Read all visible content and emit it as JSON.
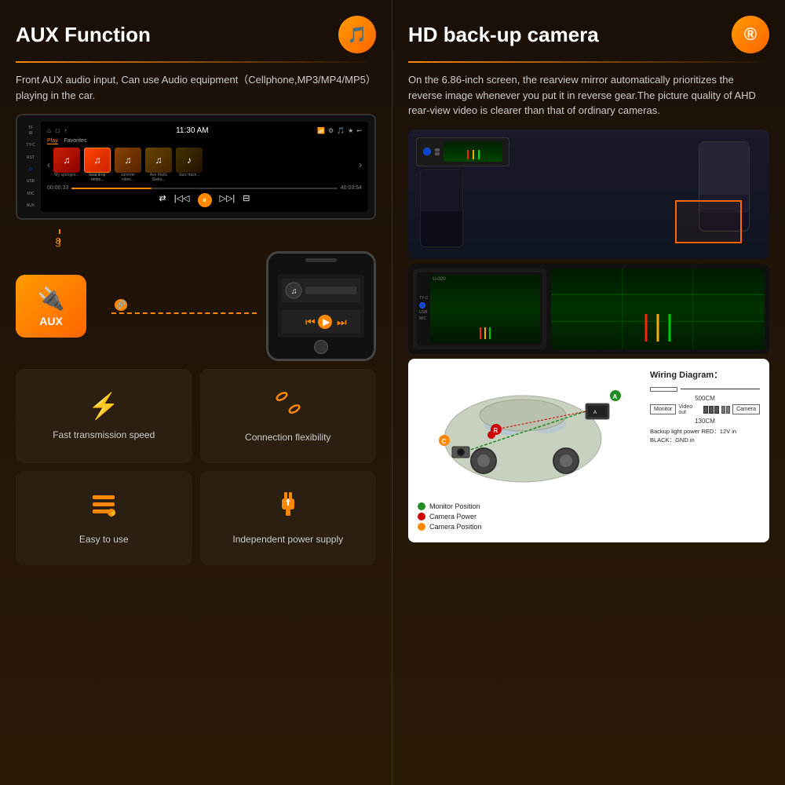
{
  "left": {
    "title": "AUX Function",
    "icon": "🎵",
    "description": "Front AUX audio input, Can use Audio equipment（Cellphone,MP3/MP4/MP5）playing in the car.",
    "stereo": {
      "time": "11:30 AM",
      "tab1": "Play",
      "tab2": "Favorites",
      "progress_start": "00:00:33",
      "progress_end": "40:03:54"
    },
    "aux_label": "AUX",
    "features": [
      {
        "icon": "⚡",
        "label": "Fast transmission speed"
      },
      {
        "icon": "🔗",
        "label": "Connection flexibility"
      },
      {
        "icon": "≡⚡",
        "label": "Easy to use"
      },
      {
        "icon": "🔌",
        "label": "Independent power supply"
      }
    ]
  },
  "right": {
    "title": "HD back-up camera",
    "icon": "®",
    "description": "On the 6.86-inch screen, the rearview mirror automatically prioritizes the reverse image whenever you put it in reverse gear.The picture quality of AHD rear-view video is clearer than that of ordinary cameras.",
    "wiring": {
      "title": "Wiring Diagram：",
      "distance1": "500CM",
      "distance2": "130CM",
      "monitor_label": "Monitor",
      "camera_label": "Camera",
      "video_out": "Video out",
      "backup_power": "Backup light power  RED：12V in",
      "black_gnd": "BLACK：GND in"
    },
    "legend": {
      "a": "Monitor Position",
      "r": "Camera Power",
      "c": "Camera Position"
    }
  }
}
